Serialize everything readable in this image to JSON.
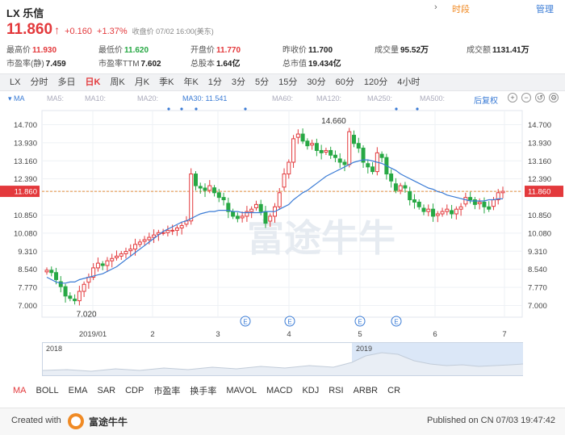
{
  "header": {
    "title": "LX 乐信",
    "price": "11.860",
    "change": "+0.160",
    "change_pct": "+1.37%",
    "status": "收盘价 07/02 16:00(美东)"
  },
  "stats": [
    [
      {
        "label": "最高价",
        "value": "11.930",
        "tone": "red"
      },
      {
        "label": "最低价",
        "value": "11.620",
        "tone": "green"
      },
      {
        "label": "开盘价",
        "value": "11.770",
        "tone": "red"
      },
      {
        "label": "昨收价",
        "value": "11.700",
        "tone": "plain"
      },
      {
        "label": "成交量",
        "value": "95.52万",
        "tone": "plain"
      },
      {
        "label": "成交额",
        "value": "1131.41万",
        "tone": "plain"
      }
    ],
    [
      {
        "label": "市盈率(静)",
        "value": "7.459",
        "tone": "plain"
      },
      {
        "label": "市盈率TTM",
        "value": "7.602",
        "tone": "plain"
      },
      {
        "label": "总股本",
        "value": "1.64亿",
        "tone": "plain"
      },
      {
        "label": "总市值",
        "value": "19.434亿",
        "tone": "plain"
      }
    ]
  ],
  "period_tabs": [
    "LX",
    "分时",
    "多日",
    "日K",
    "周K",
    "月K",
    "季K",
    "年K",
    "1分",
    "3分",
    "5分",
    "15分",
    "30分",
    "60分",
    "120分",
    "4小时"
  ],
  "active_period": "日K",
  "ma_bar": {
    "toggle": "MA",
    "labels": [
      "MA5:",
      "MA10:",
      "MA20:",
      "MA30: 11.541",
      "MA60:",
      "MA120:",
      "MA250:",
      "MA500:"
    ],
    "adjust": "后复权"
  },
  "chart_data": {
    "type": "candlestick",
    "ylim": [
      6.5,
      15.3
    ],
    "yticks_left": [
      "14.700",
      "13.930",
      "13.160",
      "12.390",
      "11.860",
      "10.850",
      "10.080",
      "9.310",
      "8.540",
      "7.770",
      "7.000"
    ],
    "yticks_right": [
      "14.700",
      "13.930",
      "13.160",
      "12.390",
      "11.860",
      "10.850",
      "10.080",
      "9.310",
      "8.540",
      "7.770",
      "7.000"
    ],
    "xticks": [
      "2019/01",
      "2",
      "3",
      "4",
      "5",
      "6",
      "7"
    ],
    "current_price": 11.86,
    "max_label": "14.660",
    "min_label": "7.020",
    "event_markers": [
      "E",
      "E",
      "E",
      "E"
    ],
    "watermark": "富途牛牛",
    "closes": [
      8.5,
      8.4,
      8.1,
      7.8,
      7.4,
      7.3,
      7.2,
      7.6,
      7.9,
      8.2,
      8.6,
      8.8,
      8.7,
      8.9,
      9.0,
      9.1,
      9.2,
      9.3,
      9.4,
      9.6,
      9.7,
      9.8,
      9.9,
      10.0,
      10.1,
      10.1,
      10.2,
      10.2,
      10.3,
      10.4,
      10.6,
      12.6,
      12.1,
      12.0,
      11.9,
      12.1,
      11.8,
      11.6,
      11.5,
      11.0,
      10.8,
      10.7,
      10.8,
      11.0,
      11.1,
      11.3,
      11.0,
      10.5,
      10.8,
      11.2,
      11.8,
      12.6,
      13.1,
      14.1,
      14.3,
      14.0,
      13.8,
      13.9,
      13.6,
      13.5,
      13.6,
      13.4,
      13.3,
      13.1,
      13.0,
      14.4,
      13.9,
      13.7,
      13.1,
      12.9,
      12.7,
      13.5,
      13.3,
      12.6,
      12.3,
      11.9,
      12.1,
      12.0,
      11.5,
      11.4,
      11.2,
      11.0,
      11.1,
      10.8,
      10.9,
      11.0,
      11.1,
      10.9,
      11.1,
      11.2,
      11.6,
      11.5,
      11.3,
      11.4,
      11.2,
      11.1,
      11.5,
      11.8,
      11.86
    ],
    "ma30": [
      8.2,
      8.1,
      8.0,
      7.95,
      7.95,
      8.0,
      8.0,
      8.1,
      8.15,
      8.2,
      8.25,
      8.3,
      8.35,
      8.45,
      8.55,
      8.65,
      8.8,
      8.95,
      9.1,
      9.25,
      9.4,
      9.55,
      9.7,
      9.85,
      10.0,
      10.15,
      10.25,
      10.35,
      10.45,
      10.55,
      10.6,
      10.7,
      10.8,
      10.9,
      10.95,
      11.0,
      11.0,
      11.05,
      11.05,
      11.05,
      11.0,
      11.0,
      10.95,
      10.95,
      10.95,
      10.95,
      10.95,
      11.0,
      11.0,
      11.0,
      11.1,
      11.2,
      11.3,
      11.5,
      11.65,
      11.8,
      11.9,
      12.05,
      12.2,
      12.35,
      12.5,
      12.6,
      12.7,
      12.8,
      12.9,
      13.0,
      13.1,
      13.15,
      13.2,
      13.2,
      13.15,
      13.1,
      13.05,
      12.95,
      12.85,
      12.75,
      12.6,
      12.5,
      12.4,
      12.3,
      12.2,
      12.1,
      12.0,
      11.95,
      11.85,
      11.8,
      11.7,
      11.65,
      11.6,
      11.55,
      11.5,
      11.45,
      11.45,
      11.45,
      11.45,
      11.5,
      11.5,
      11.54,
      11.54
    ]
  },
  "navigator": {
    "labels": [
      "2018",
      "2019"
    ]
  },
  "indicators": [
    "MA",
    "BOLL",
    "EMA",
    "SAR",
    "CDP",
    "市盈率",
    "换手率",
    "MAVOL",
    "MACD",
    "KDJ",
    "RSI",
    "ARBR",
    "CR"
  ],
  "active_indicator": "MA",
  "indicator_more": "›",
  "time_segment": "时段",
  "manage": "管理",
  "footer": {
    "created_with": "Created with",
    "brand": "富途牛牛",
    "published": "Published on CN 07/03 19:47:42"
  },
  "colors": {
    "up": "#e3393c",
    "down": "#27a844",
    "ma30": "#3a7bd5",
    "accent": "#3a7bd5"
  }
}
